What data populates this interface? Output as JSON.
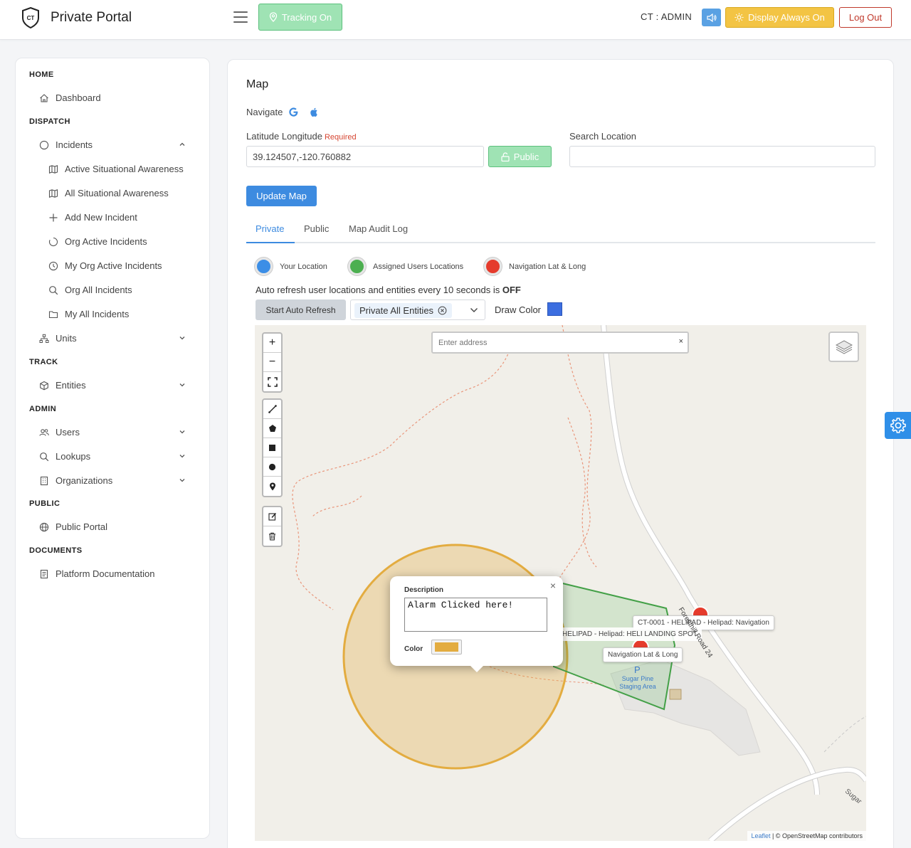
{
  "header": {
    "brand": "Private Portal",
    "logo_text": "CT",
    "tracking_label": "Tracking On",
    "admin_label": "CT : ADMIN",
    "display_label": "Display Always On",
    "logout_label": "Log Out"
  },
  "sidebar": {
    "sections": {
      "home": "HOME",
      "dispatch": "DISPATCH",
      "track": "TRACK",
      "admin": "ADMIN",
      "public": "PUBLIC",
      "documents": "DOCUMENTS"
    },
    "items": {
      "dashboard": "Dashboard",
      "incidents": "Incidents",
      "active_sa": "Active Situational Awareness",
      "all_sa": "All Situational Awareness",
      "add_incident": "Add New Incident",
      "org_active": "Org Active Incidents",
      "my_org_active": "My Org Active Incidents",
      "org_all": "Org All Incidents",
      "my_all": "My All Incidents",
      "units": "Units",
      "entities": "Entities",
      "users": "Users",
      "lookups": "Lookups",
      "organizations": "Organizations",
      "public_portal": "Public Portal",
      "platform_docs": "Platform Documentation"
    }
  },
  "main": {
    "title": "Map",
    "navigate_label": "Navigate",
    "latlng_label": "Latitude Longitude",
    "required_label": "Required",
    "latlng_value": "39.124507,-120.760882",
    "public_btn": "Public",
    "search_label": "Search Location",
    "search_value": "",
    "update_btn": "Update Map",
    "tabs": [
      "Private",
      "Public",
      "Map Audit Log"
    ],
    "legend": {
      "your_location": "Your Location",
      "assigned": "Assigned Users Locations",
      "navigation": "Navigation Lat & Long"
    },
    "refresh_note_prefix": "Auto refresh user locations and entities every 10 seconds is",
    "refresh_state": "OFF",
    "start_refresh_btn": "Start Auto Refresh",
    "entities_chip": "Private All Entities",
    "draw_color_label": "Draw Color",
    "colors": {
      "your_location": "#3c8ee6",
      "assigned": "#4caf50",
      "navigation": "#e53b2c",
      "draw": "#3c6ee0",
      "circle_fill": "#e3ac40"
    }
  },
  "map": {
    "address_placeholder": "Enter address",
    "address_clear": "×",
    "popup": {
      "description_label": "Description",
      "description_value": "Alarm Clicked here!",
      "color_label": "Color",
      "close": "×"
    },
    "tooltips": {
      "helipad_nav": "CT-0001 - HELIPAD - Helipad: Navigation",
      "helipad_spot": "HELIPAD - Helipad: HELI LANDING SPOT",
      "nav_latlng": "Navigation Lat & Long"
    },
    "labels": {
      "road": "Foresthill Road 24",
      "staging_p": "P",
      "staging": "Sugar Pine Staging Area",
      "sugar_road": "Sugar"
    },
    "attribution_leaflet": "Leaflet",
    "attribution_rest": " | © OpenStreetMap contributors"
  }
}
